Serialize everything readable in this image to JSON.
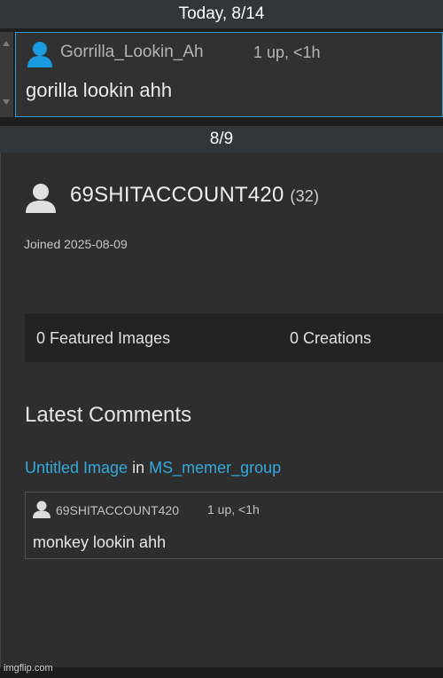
{
  "header_today": "Today, 8/14",
  "top_comment": {
    "username": "Gorrilla_Lookin_Ah",
    "meta": "1 up, <1h",
    "text": "gorilla lookin ahh",
    "avatar_color": "#1a9be0"
  },
  "header_date2": "8/9",
  "profile": {
    "username": "69SHITACCOUNT420",
    "points": "(32)",
    "joined": "Joined 2025-08-09",
    "featured": "0 Featured Images",
    "creations": "0 Creations",
    "latest_title": "Latest Comments",
    "ref_link": "Untitled Image",
    "ref_in": "in",
    "ref_group": "MS_memer_group",
    "comment": {
      "username": "69SHITACCOUNT420",
      "meta": "1 up, <1h",
      "text": "monkey lookin ahh"
    }
  },
  "watermark": "imgflip.com",
  "link_color": "#33a9dd"
}
